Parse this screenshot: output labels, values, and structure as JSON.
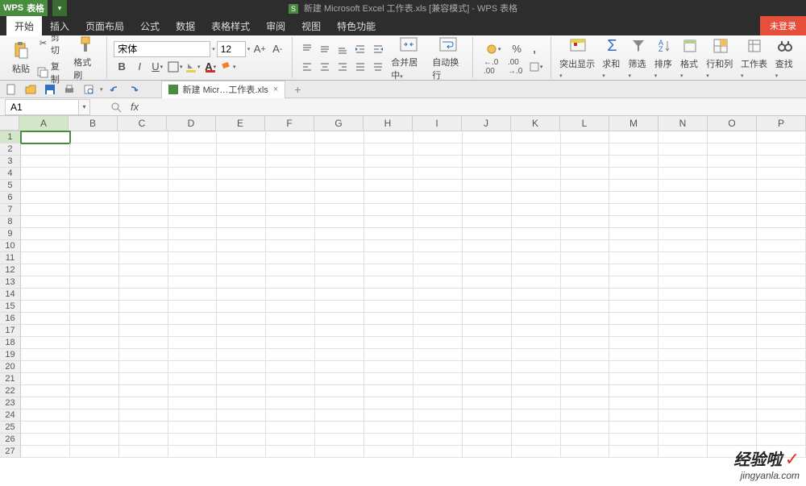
{
  "title_bar": {
    "app_logo": "WPS",
    "app_name": "表格",
    "doc_title": "新建 Microsoft Excel 工作表.xls [兼容模式] - WPS 表格"
  },
  "login_badge": "未登录",
  "menu": {
    "items": [
      "开始",
      "插入",
      "页面布局",
      "公式",
      "数据",
      "表格样式",
      "审阅",
      "视图",
      "特色功能"
    ],
    "active_index": 0
  },
  "ribbon": {
    "paste": "粘贴",
    "cut": "剪切",
    "copy": "复制",
    "format_painter": "格式刷",
    "font_name": "宋体",
    "font_size": "12",
    "merge_center": "合并居中",
    "wrap_text": "自动换行",
    "number_sample": ".00",
    "percent": "%",
    "comma": ",",
    "inc_dec1": ".0",
    "inc_dec2": ".00",
    "highlight": "突出显示",
    "sum": "求和",
    "filter": "筛选",
    "sort": "排序",
    "format": "格式",
    "row_col": "行和列",
    "worksheet": "工作表",
    "find": "查找"
  },
  "doc_tab": {
    "label": "新建 Micr…工作表.xls"
  },
  "formula_bar": {
    "cell_ref": "A1",
    "fx": "fx",
    "value": ""
  },
  "grid": {
    "columns": [
      "A",
      "B",
      "C",
      "D",
      "E",
      "F",
      "G",
      "H",
      "I",
      "J",
      "K",
      "L",
      "M",
      "N",
      "O",
      "P"
    ],
    "row_count": 27,
    "active_cell": "A1"
  },
  "watermark": {
    "line1": "经验啦",
    "check": "✓",
    "line2": "jingyanla.com"
  }
}
